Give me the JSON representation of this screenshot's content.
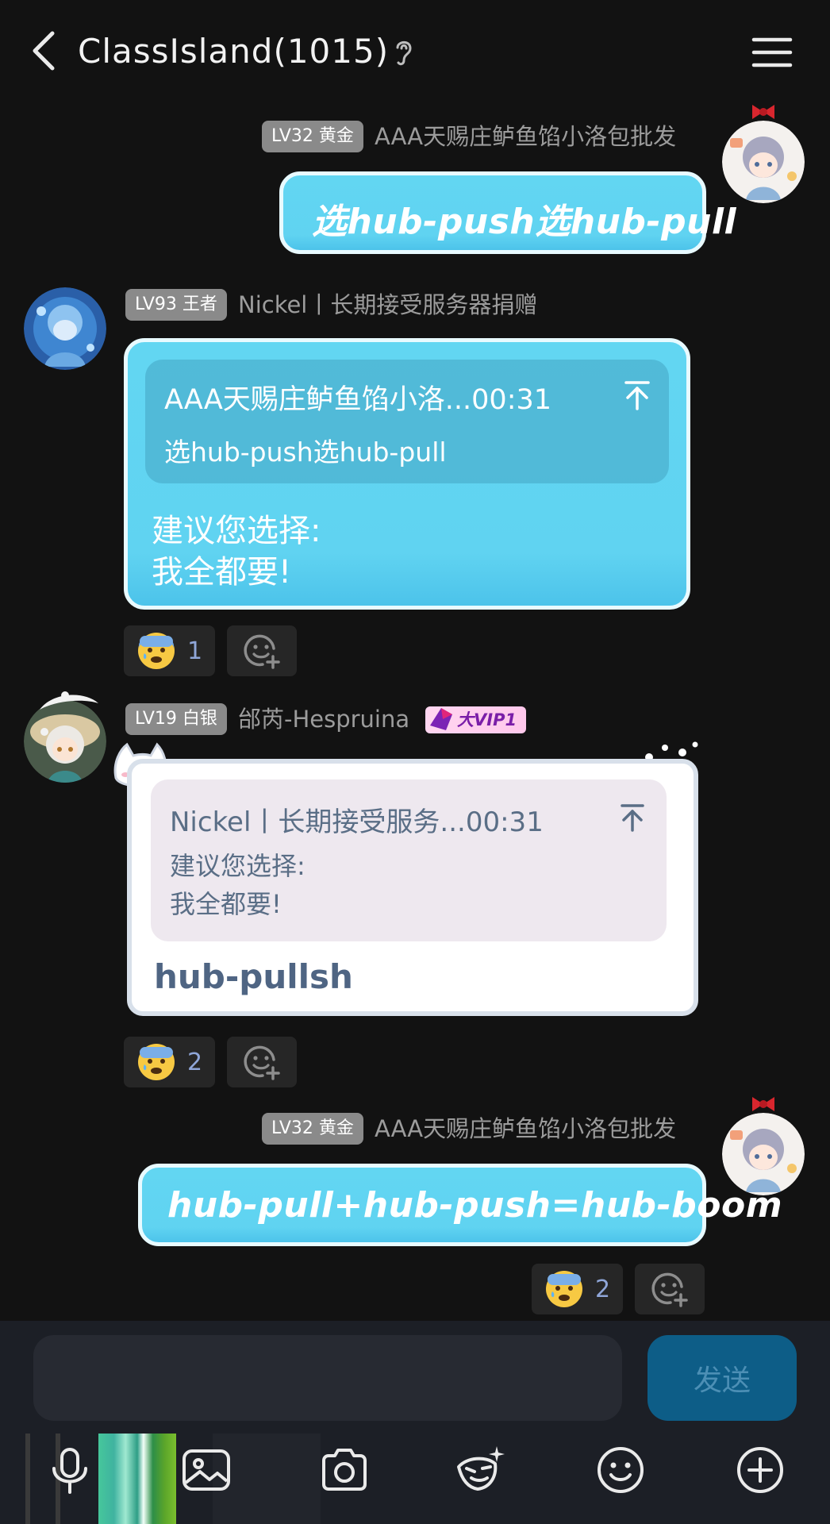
{
  "header": {
    "title": "ClassIsland(1015)"
  },
  "messages": [
    {
      "level": "LV32 黄金",
      "sender": "AAA天赐庄鲈鱼馅小洛包批发",
      "text": "选hub-push选hub-pull"
    },
    {
      "level": "LV93 王者",
      "sender": "Nickel丨长期接受服务器捐赠",
      "quote_sender": "AAA天赐庄鲈鱼馅小洛...00:31",
      "quote_text": "选hub-push选hub-pull",
      "reply_line1": "建议您选择:",
      "reply_line2": "我全都要!",
      "reactions": [
        {
          "emoji": "anxious-sweat-face",
          "count": "1"
        }
      ]
    },
    {
      "level": "LV19 白银",
      "sender": "邰芮-Hespruina",
      "vip": "大VIP1",
      "quote_sender": "Nickel丨长期接受服务...00:31",
      "quote_line1": "建议您选择:",
      "quote_line2": "我全都要!",
      "reply": "hub-pullsh",
      "reactions": [
        {
          "emoji": "anxious-sweat-face",
          "count": "2"
        }
      ]
    },
    {
      "level": "LV32 黄金",
      "sender": "AAA天赐庄鲈鱼馅小洛包批发",
      "text": "hub-pull+hub-push=hub-boom",
      "reactions": [
        {
          "emoji": "anxious-sweat-face",
          "count": "2"
        }
      ]
    }
  ],
  "composer": {
    "input_value": "",
    "send_label": "发送"
  },
  "toolbar": {
    "icons": [
      "microphone-icon",
      "image-icon",
      "camera-icon",
      "sticker-icon",
      "emoji-icon",
      "plus-icon"
    ]
  },
  "colors": {
    "background": "#121212",
    "bubble_blue": "#60d3f1",
    "send_button": "#0d5d87"
  }
}
